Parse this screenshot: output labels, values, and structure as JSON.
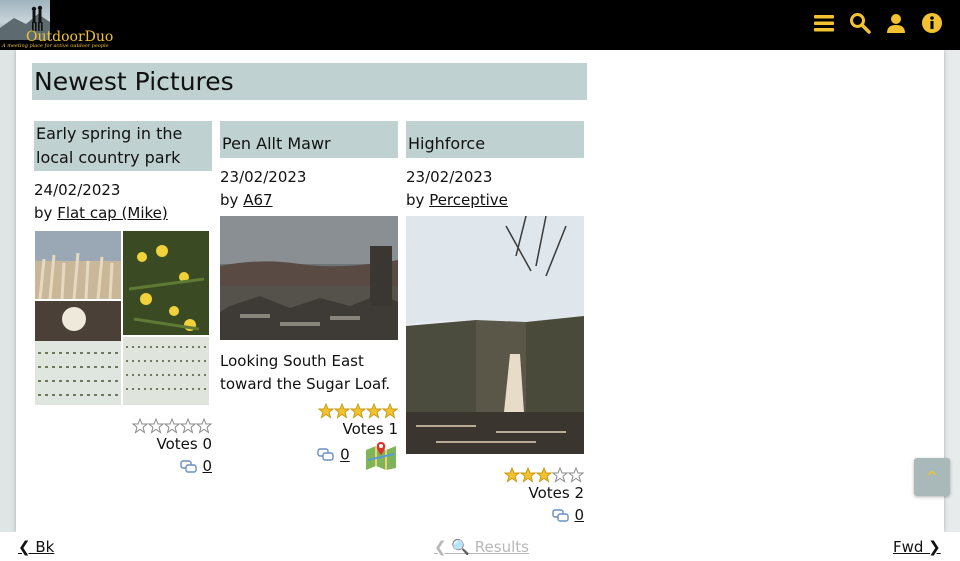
{
  "header": {
    "logo_name": "OutdoorDuo",
    "logo_tagline": "A meeting place for active outdoor people",
    "icons": [
      "menu-icon",
      "search-icon",
      "user-icon",
      "info-icon"
    ],
    "accent": "#f2c230"
  },
  "section": {
    "title": "Newest Pictures"
  },
  "cards": [
    {
      "title": "Early spring in the local country park",
      "date": "24/02/2023",
      "by": "by",
      "user": "Flat cap (Mike)",
      "caption": "",
      "rating": 0,
      "votes": "Votes 0",
      "comments": "0",
      "has_map": false
    },
    {
      "title": "Pen Allt Mawr",
      "date": "23/02/2023",
      "by": "by",
      "user": "A67",
      "caption": "Looking South East toward the Sugar Loaf.",
      "rating": 5,
      "votes": "Votes 1",
      "comments": "0",
      "has_map": true
    },
    {
      "title": "Highforce",
      "date": "23/02/2023",
      "by": "by",
      "user": "Perceptive",
      "caption": "",
      "rating": 3,
      "votes": "Votes 2",
      "comments": "0",
      "has_map": false
    }
  ],
  "scroll_top": {
    "label": "^"
  },
  "footer": {
    "back": "❮ Bk",
    "results": "❮ 🔍 Results",
    "forward": "Fwd ❯"
  }
}
